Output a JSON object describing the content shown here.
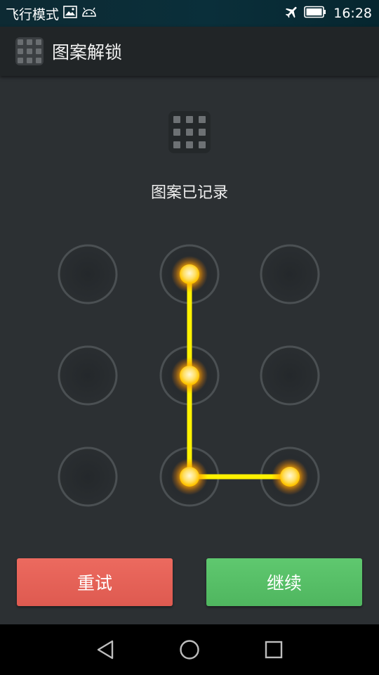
{
  "status_bar": {
    "carrier_text": "飞行模式",
    "time": "16:28",
    "icons": [
      "image-icon",
      "android-icon",
      "airplane-icon",
      "battery-icon"
    ]
  },
  "action_bar": {
    "title": "图案解锁",
    "icon": "pattern-grid-icon"
  },
  "header": {
    "icon": "pattern-grid-icon",
    "prompt": "图案已记录"
  },
  "pattern": {
    "grid": "3x3",
    "selected_nodes": [
      2,
      5,
      8,
      9
    ],
    "line_color": "#ffee00",
    "node_glow_color": "#ffb000"
  },
  "buttons": {
    "retry_label": "重试",
    "retry_color": "#e5635a",
    "continue_label": "继续",
    "continue_color": "#58c068"
  },
  "nav_bar": {
    "icons": [
      "back-icon",
      "home-icon",
      "recents-icon"
    ]
  }
}
